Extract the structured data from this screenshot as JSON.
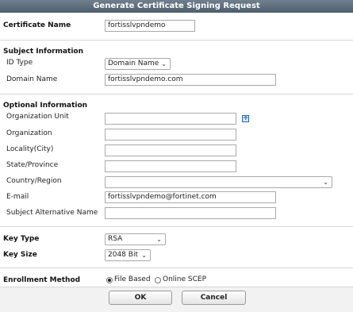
{
  "dialog": {
    "title": "Generate Certificate Signing Request"
  },
  "certificate_name": {
    "label": "Certificate Name",
    "value": "fortisslvpndemo"
  },
  "subject": {
    "heading": "Subject Information",
    "id_type_label": "ID Type",
    "id_type_value": "Domain Name",
    "domain_name_label": "Domain Name",
    "domain_name_value": "fortisslvpndemo.com"
  },
  "optional": {
    "heading": "Optional Information",
    "org_unit_label": "Organization Unit",
    "org_unit_value": "",
    "organization_label": "Organization",
    "organization_value": "",
    "locality_label": "Locality(City)",
    "locality_value": "",
    "state_label": "State/Province",
    "state_value": "",
    "country_label": "Country/Region",
    "country_value": "",
    "email_label": "E-mail",
    "email_value": "fortisslvpndemo@fortinet.com",
    "san_label": "Subject Alternative Name",
    "san_value": ""
  },
  "key": {
    "type_label": "Key Type",
    "type_value": "RSA",
    "size_label": "Key Size",
    "size_value": "2048 Bit"
  },
  "enrollment": {
    "label": "Enrollment Method",
    "option_file": "File Based",
    "option_scep": "Online SCEP",
    "selected": "File Based"
  },
  "buttons": {
    "ok": "OK",
    "cancel": "Cancel"
  },
  "icons": {
    "add": "plus-icon",
    "dropdown": "chevron-down-icon"
  }
}
